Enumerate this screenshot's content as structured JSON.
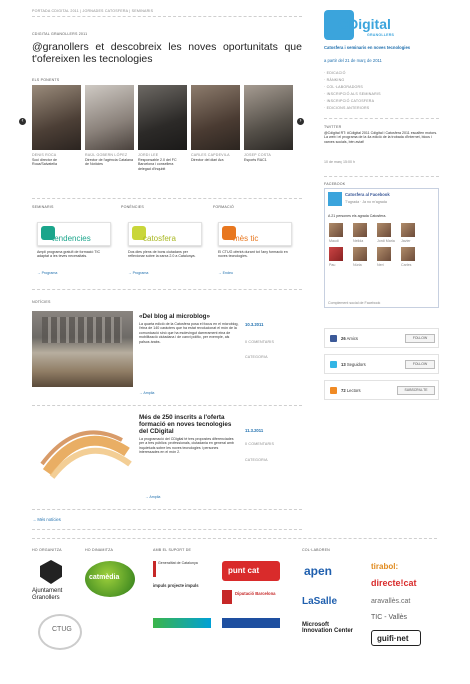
{
  "topnav": [
    "PORTADA CDIGITAL 2011",
    "JORNADES CATOSFERA",
    "SEMINARIS"
  ],
  "kicker": "CDIGITAL GRANOLLERS 2011",
  "headline": "@granollers et descobreix les noves oportunitats que t'ofereixen les tecnologies",
  "speakers_title": "ELS PONENTS",
  "speakers": [
    {
      "name": "DENIS ROCA",
      "desc": "Soci director de Roca/Salvatella"
    },
    {
      "name": "RAÜL GOBERN LÓPEZ",
      "desc": "Director de l'agència Catalana de Notícies"
    },
    {
      "name": "JORDI LEE",
      "desc": "Responsable 2.0 del FC Barcelona i consellera delegad d'Inqubit"
    },
    {
      "name": "CARLES CAPDEVILA",
      "desc": "Director del diari Ara"
    },
    {
      "name": "JOSEP COSTA",
      "desc": "Esports RAC1"
    }
  ],
  "sections": [
    {
      "head": "SEMINARIS",
      "logo": "tendencies",
      "text": "Ampli programa gratuït de formació TIC adaptat a les teves necessitats.",
      "link": "→ Programa"
    },
    {
      "head": "PONÈNCIES",
      "logo": "catosfera",
      "text": "Dos dies plens de bons ciutadans per reflexionar sobre la xarxa 2.0 a Catalunya.",
      "link": "→ Programa"
    },
    {
      "head": "FORMACIÓ",
      "logo": "mès tic",
      "text": "El CTUG oferirà durant tot l'any formació en noves tecnologies.",
      "link": "→ Endeu"
    }
  ],
  "news_title": "NOTÍCIES",
  "news": [
    {
      "title": "«Del blog al microblog»",
      "body": "La quarta edició de la Catosfera posa el focus en el microblog, l'eina de 140 caràcters que ha estat revolucionat el món de la comunicació sinó que ha esdevingut darrerament eina de mobilització ciutadana i de canvi polític, per exemple, als països àrabs.",
      "date": "10.3.2011",
      "comments": "0 COMENTARIS",
      "category": "CATEGORIA",
      "more": "→ Amplia"
    },
    {
      "title": "Més de 250 inscrits a l'oferta formació en noves tecnologies del CDigital",
      "body": "La programació del CDigital té tres propostes diferenciades per a tres públics: professionals, ciutadania en general amb inquietuds sobre les noves tecnologies i persones interessades en el món 2.",
      "date": "11.3.2011",
      "comments": "0 COMENTARIS",
      "category": "CATEGORIA",
      "more": "→ Amplia"
    }
  ],
  "more_news": "→ Més notícies",
  "footer": {
    "cols": [
      "HO ORGANITZA",
      "HO DINAMITZA",
      "AMB EL SUPORT DE",
      "COL·LABOREN"
    ],
    "org": [
      "Ajuntament Granollers",
      "CTUG"
    ],
    "dyn": "catmèdia",
    "support": [
      "punt cat",
      "Diputació Barcelona",
      "impuls projecte impuls",
      "Generalitat de Catalunya",
      "Microsoft Innovation Center"
    ],
    "collab": [
      "apen",
      "tirabol:",
      "directe!cat",
      "LaSalle",
      "aravallès.cat",
      "TIC - Vallès",
      "guifi·net"
    ]
  },
  "sidebar": {
    "brand": "CDigital",
    "brand_sub": "GRANOLLERS",
    "event_title": "Catosfera i seminaris en noves tecnologies",
    "event_sub": "a partir del 21 de març de 2011",
    "menu": [
      "· EDICACIÓ",
      "· RÀNKING",
      "· COL·LABORADORS",
      "· INSCRIPCIÓ ALS SEMINARIS",
      "· INSCRIPCIÓ CATOSFERA",
      "· EDICIONS ANTERIORS"
    ],
    "twitter_head": "TWITTER",
    "tweet": "@Cdigital RT: #Cdigital 2011 Cdigital i Catosfera 2011 escalfen motors. La web i el programa de la 4a edició de la trobada d'Internet, blocs i xarxes socials, bén aviat!",
    "tweet_meta": "10 de març 15:00 h",
    "facebook_head": "FACEBOOK",
    "fb_page": "Catosfera al Facebook",
    "fb_like": "T'agrada · Ja no m'agrada",
    "fb_count": "A 21 persones els agrada Catosfera.",
    "fb_names": [
      "Maudi",
      "Nelida",
      "Jordi Maria",
      "Javier",
      "Pau",
      "Núria",
      "Neri",
      "Carles"
    ],
    "fb_plugin": "Complement social de Facebook",
    "social": [
      {
        "icon": "facebook-icon",
        "count": "26",
        "label": "Amics",
        "btn": "FOLLOW"
      },
      {
        "icon": "twitter-icon",
        "count": "13",
        "label": "Seguidors",
        "btn": "FOLLOW"
      },
      {
        "icon": "rss-icon",
        "count": "72",
        "label": "Lectors",
        "btn": "SUBSCRIU-TE"
      }
    ]
  }
}
